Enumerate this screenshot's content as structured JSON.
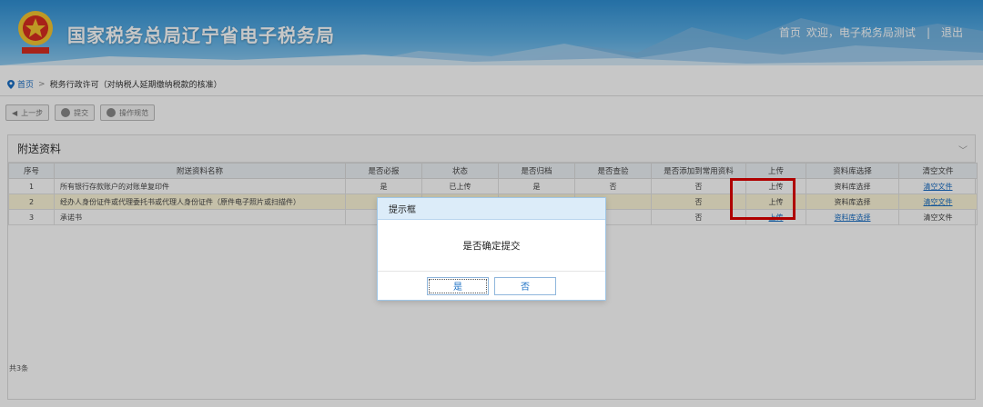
{
  "header": {
    "title": "国家税务总局辽宁省电子税务局",
    "links": {
      "home": "首页",
      "welcome": "欢迎，电子税务局测试",
      "separator": "|",
      "logout": "退出"
    }
  },
  "breadcrumb": {
    "home": "首页",
    "arrow": ">",
    "current": "税务行政许可（对纳税人延期缴纳税款的核准）"
  },
  "toolbar": {
    "prev": "上一步",
    "submit": "提交",
    "guide": "操作规范"
  },
  "panel": {
    "title": "附送资料",
    "columns": [
      "序号",
      "附送资料名称",
      "是否必报",
      "状态",
      "是否归档",
      "是否查验",
      "是否添加到常用资料",
      "上传",
      "资料库选择",
      "清空文件"
    ],
    "rows": [
      {
        "no": "1",
        "name": "所有银行存款账户的对账单复印件",
        "required": "是",
        "status": "已上传",
        "archive": "是",
        "verify": "否",
        "common": "否",
        "upload": "上传",
        "library": "资料库选择",
        "clear": "清空文件"
      },
      {
        "no": "2",
        "name": "经办人身份证件或代理委托书或代理人身份证件（原件电子照片或扫描件）",
        "required": "",
        "status": "",
        "archive": "",
        "verify": "",
        "common": "否",
        "upload": "上传",
        "library": "资料库选择",
        "clear": "清空文件"
      },
      {
        "no": "3",
        "name": "承诺书",
        "required": "",
        "status": "",
        "archive": "",
        "verify": "",
        "common": "否",
        "upload": "上传",
        "library": "资料库选择",
        "clear": "清空文件"
      }
    ],
    "count": "共3条"
  },
  "dialog": {
    "title": "提示框",
    "message": "是否确定提交",
    "yes": "是",
    "no": "否"
  },
  "colors": {
    "accent": "#1a6fc4",
    "highlight": "#e00000",
    "dialog_header": "#dcecf9"
  }
}
